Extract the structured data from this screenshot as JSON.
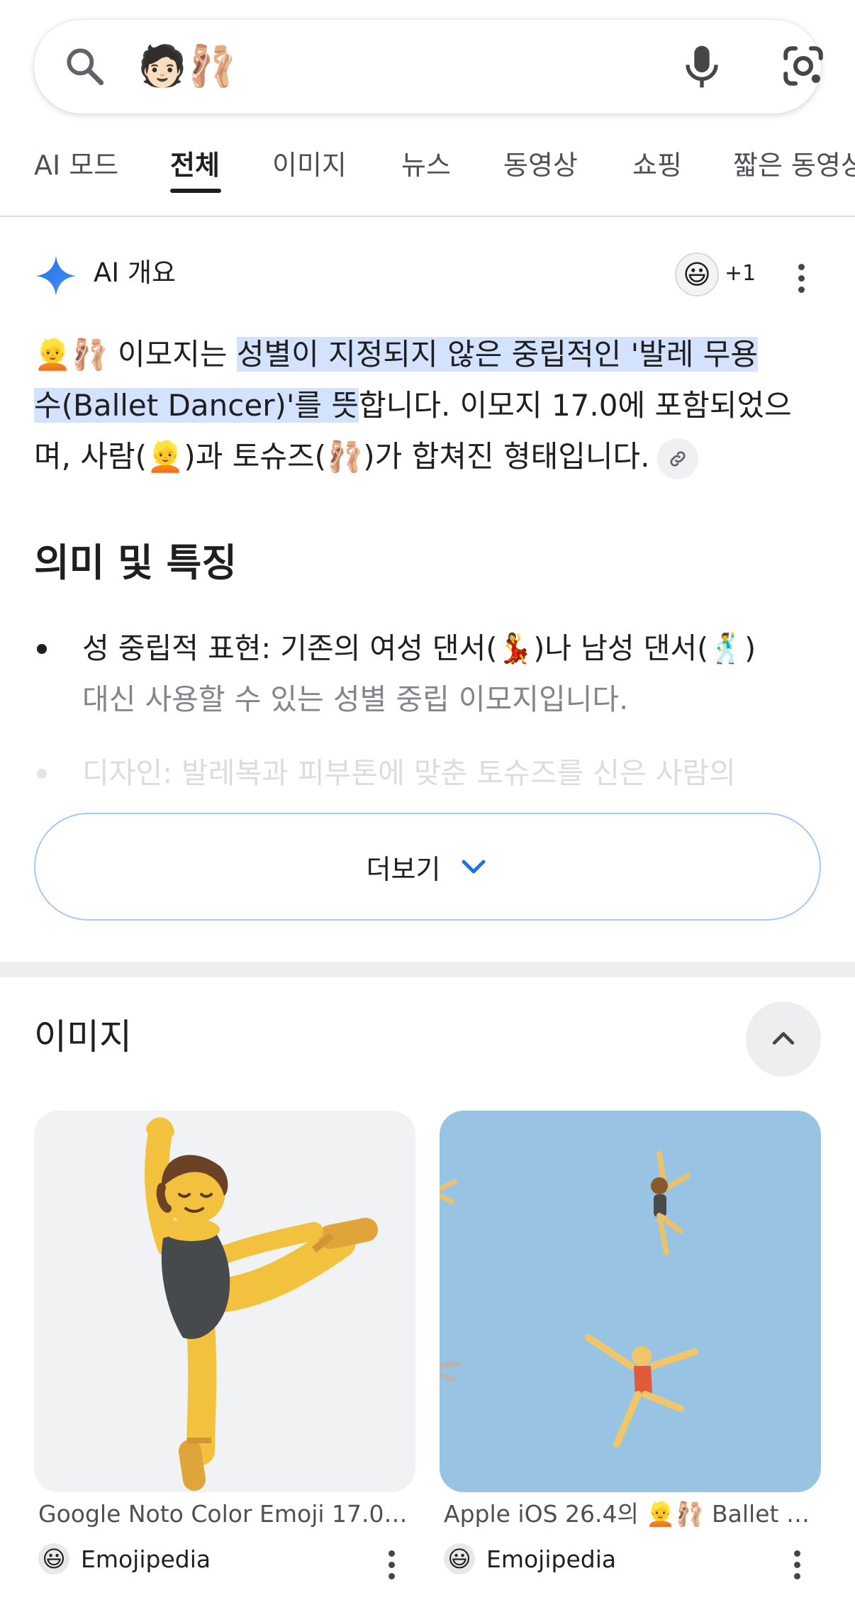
{
  "search": {
    "query": "🧑🏻🩰"
  },
  "tabs": [
    {
      "label": "AI 모드"
    },
    {
      "label": "전체"
    },
    {
      "label": "이미지"
    },
    {
      "label": "뉴스"
    },
    {
      "label": "동영상"
    },
    {
      "label": "쇼핑"
    },
    {
      "label": "짧은 동영상"
    }
  ],
  "ai_overview": {
    "title": "AI 개요",
    "source_avatar": "😃",
    "source_count": "+1",
    "paragraph": {
      "lead_emoji": "👱🩰",
      "p1": " 이모지는 ",
      "hl1": "성별이 지정되지 않은 중립적인 '발레 무용",
      "hl2": "수(Ballet Dancer)'를 뜻",
      "p2": "합니다. 이모지 17.0에 포함되었으",
      "p3": "며, 사람(",
      "emoji_person": "👱",
      "p4": ")과 토슈즈(",
      "emoji_shoes": "🩰",
      "p5": ")가 합쳐진 형태입니다."
    },
    "section_heading": "의미 및 특징",
    "bullet1": {
      "t1": "성 중립적 표현: 기존의 여성 댄서(",
      "e1": "💃",
      "t2": ")나 남성 댄서(",
      "e2": "🕺",
      "t3": ")",
      "line2": "대신 사용할 수 있는 성별 중립 이모지입니다."
    },
    "bullet2": {
      "text": "디자인: 발레복과 피부톤에 맞춘 토슈즈를 신은 사람의"
    },
    "more_label": "더보기"
  },
  "images": {
    "heading": "이미지",
    "cards": [
      {
        "caption": "Google Noto Color Emoji 17.0의…",
        "source": "Emojipedia",
        "favicon": "😃"
      },
      {
        "caption": "Apple iOS 26.4의 👱🩰 Ballet D…",
        "source": "Emojipedia",
        "favicon": "😃"
      }
    ]
  },
  "colors": {
    "highlight": "#d3e3fd",
    "accent": "#1a73e8",
    "more_border": "#a8c7fa",
    "right_image_bg": "#98c3e3"
  }
}
